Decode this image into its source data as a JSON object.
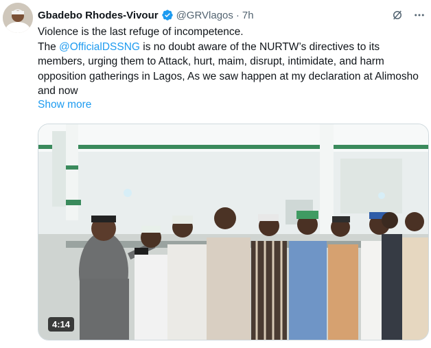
{
  "tweet": {
    "author_name": "Gbadebo Rhodes-Vivour",
    "handle": "@GRVlagos",
    "separator": "·",
    "time": "7h",
    "line1": "Violence is the last refuge of incompetence.",
    "body_prefix": "The ",
    "mention": "@OfficialDSSNG",
    "body_rest": " is no doubt aware of the NURTW’s directives to its members, urging them to Attack, hurt, maim, disrupt, intimidate, and harm opposition gatherings in Lagos, As we saw happen at my declaration at Alimosho and now",
    "show_more": "Show more"
  },
  "media": {
    "duration": "4:14"
  },
  "icons": {
    "verified": "verified-badge-icon",
    "grok": "grok-icon",
    "more": "more-options-icon"
  },
  "colors": {
    "accent": "#1d9bf0",
    "text": "#0f1419",
    "secondary": "#536471"
  }
}
